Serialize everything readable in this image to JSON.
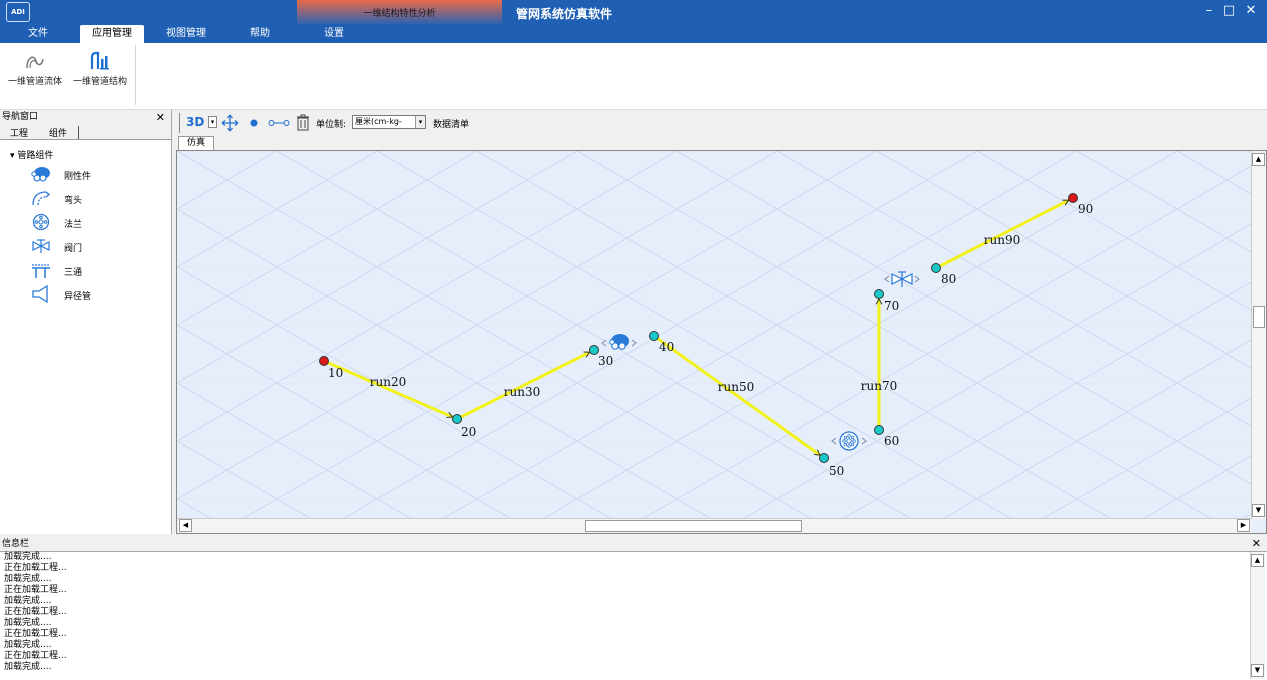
{
  "app": {
    "logo": "ADI",
    "title": "管网系统仿真软件",
    "context_tab": "一维结构特性分析",
    "window_controls": [
      "–",
      "□",
      "✕"
    ]
  },
  "menu": {
    "tabs": [
      "文件",
      "应用管理",
      "视图管理",
      "帮助",
      "设置"
    ],
    "active": "应用管理"
  },
  "ribbon": {
    "buttons": [
      {
        "label": "一维管道流体",
        "icon": "fluid-pipe-icon"
      },
      {
        "label": "一维管道结构",
        "icon": "structure-pipe-icon"
      }
    ]
  },
  "nav": {
    "title": "导航窗口",
    "close": "✕",
    "tabs": [
      "工程",
      "组件"
    ],
    "tree_root": "▾ 管路组件",
    "items": [
      {
        "label": "刚性件",
        "icon": "rigid-icon"
      },
      {
        "label": "弯头",
        "icon": "elbow-icon"
      },
      {
        "label": "法兰",
        "icon": "flange-icon"
      },
      {
        "label": "阀门",
        "icon": "valve-icon"
      },
      {
        "label": "三通",
        "icon": "tee-icon"
      },
      {
        "label": "异径管",
        "icon": "reducer-icon"
      }
    ]
  },
  "toolbar": {
    "view_mode": "3D",
    "unit_label": "单位制:",
    "unit_value": "厘米(cm-kg-",
    "data_list": "数据清单"
  },
  "view_tab": "仿真",
  "diagram": {
    "nodes": [
      {
        "id": "10",
        "color": "#d81a1a"
      },
      {
        "id": "20",
        "color": "#19c9c9"
      },
      {
        "id": "30",
        "color": "#19c9c9"
      },
      {
        "id": "40",
        "color": "#19c9c9"
      },
      {
        "id": "50",
        "color": "#19c9c9"
      },
      {
        "id": "60",
        "color": "#19c9c9"
      },
      {
        "id": "70",
        "color": "#19c9c9"
      },
      {
        "id": "80",
        "color": "#19c9c9"
      },
      {
        "id": "90",
        "color": "#d81a1a"
      }
    ],
    "runs": [
      {
        "label": "run20",
        "from": "10",
        "to": "20"
      },
      {
        "label": "run30",
        "from": "20",
        "to": "30"
      },
      {
        "label": "run50",
        "from": "40",
        "to": "50"
      },
      {
        "label": "run70",
        "from": "60",
        "to": "70"
      },
      {
        "label": "run90",
        "from": "80",
        "to": "90"
      }
    ],
    "components": [
      {
        "type": "rigid-icon",
        "between": [
          "30",
          "40"
        ]
      },
      {
        "type": "flange-icon",
        "between": [
          "50",
          "60"
        ]
      },
      {
        "type": "valve-icon",
        "between": [
          "70",
          "80"
        ]
      }
    ],
    "pipe_color": "#f2f21a",
    "grid_color": "#c9d4e8"
  },
  "info": {
    "title": "信息栏",
    "close": "✕",
    "lines": [
      "加载完成....",
      "正在加载工程...",
      "加载完成....",
      "正在加载工程...",
      "加载完成....",
      "正在加载工程...",
      "加载完成....",
      "正在加载工程...",
      "加载完成....",
      "正在加载工程...",
      "加载完成...."
    ]
  }
}
